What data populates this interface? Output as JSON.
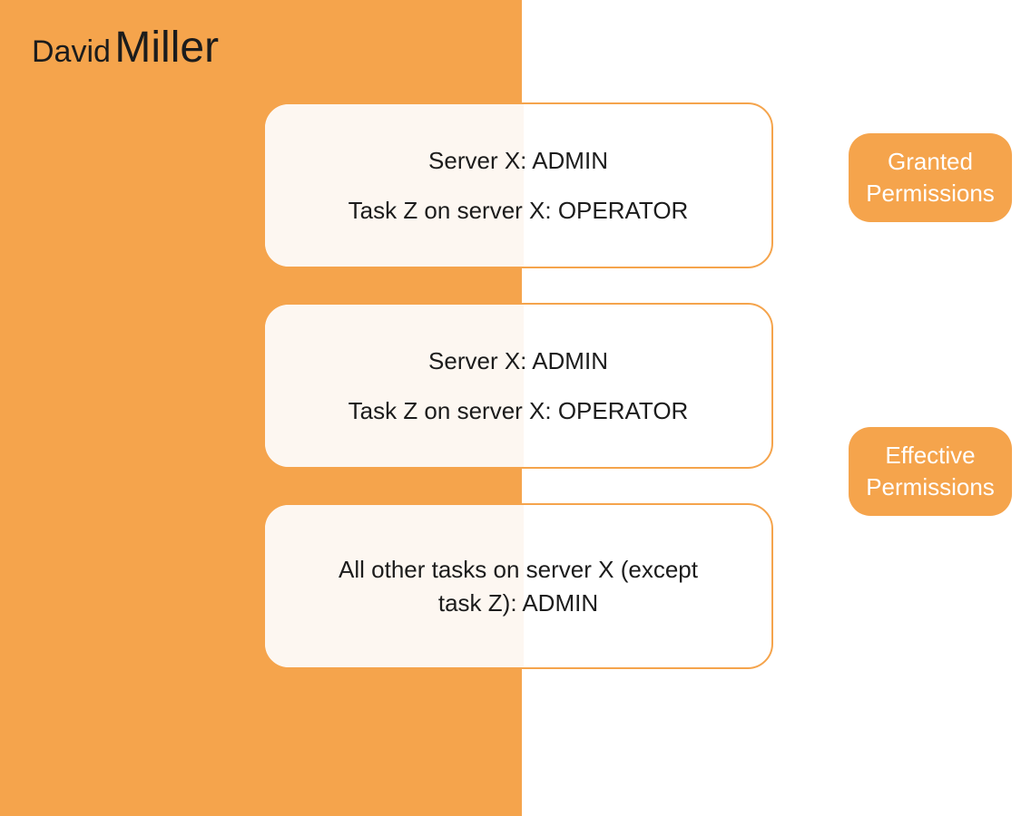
{
  "colors": {
    "orange": "#F5A44C",
    "text": "#1c1c1c",
    "tag_text": "#ffffff"
  },
  "name": {
    "first": "David",
    "last": "Miller"
  },
  "boxes": {
    "granted": {
      "line1": "Server X: ADMIN",
      "line2": "Task Z on server X: OPERATOR"
    },
    "effective1": {
      "line1": "Server X: ADMIN",
      "line2": "Task Z on server X: OPERATOR"
    },
    "effective2": {
      "line1": "All other tasks on server X (except task Z): ADMIN"
    }
  },
  "tags": {
    "granted": "Granted Permissions",
    "effective": "Effective Permissions"
  }
}
